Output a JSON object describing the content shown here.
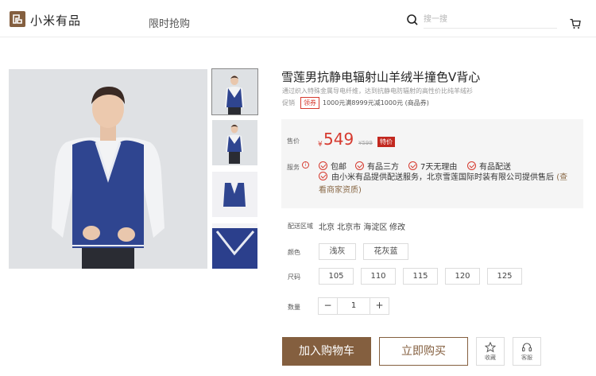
{
  "header": {
    "brand": "小米有品",
    "nav_item": "限时抢购",
    "search_placeholder": "搜一搜"
  },
  "product": {
    "title": "雪莲男抗静电辐射山羊绒半撞色V背心",
    "subtitle": "通过织入特殊金属导电纤维，达到抗静电防辐射的高性价比纯羊绒衫",
    "promo_label": "促销",
    "coupon_badge": "领券",
    "promo_text": "1000元满8999元减1000元 (商品券)"
  },
  "price": {
    "label": "售价",
    "currency": "¥",
    "value": "549",
    "original": "¥599",
    "badge": "特价"
  },
  "service": {
    "label": "服务",
    "info_icon": "i",
    "items": [
      "包邮",
      "有品三方",
      "7天无理由",
      "有品配送"
    ],
    "description": "由小米有品提供配送服务，北京雪莲国际时装有限公司提供售后",
    "merchant_link": "(查看商家资质)"
  },
  "delivery": {
    "label": "配送区域",
    "value": "北京 北京市 海淀区",
    "change": "修改"
  },
  "color": {
    "label": "颜色",
    "options": [
      "浅灰",
      "花灰蓝"
    ]
  },
  "size": {
    "label": "尺码",
    "options": [
      "105",
      "110",
      "115",
      "120",
      "125"
    ]
  },
  "quantity": {
    "label": "数量",
    "minus": "−",
    "value": "1",
    "plus": "+"
  },
  "actions": {
    "add_to_cart": "加入购物车",
    "buy_now": "立即购买",
    "favorite": "收藏",
    "customer_service": "客服"
  },
  "colors": {
    "brand": "#845f3f",
    "price_red": "#d63a2f",
    "vest_blue": "#2b3f8c"
  }
}
